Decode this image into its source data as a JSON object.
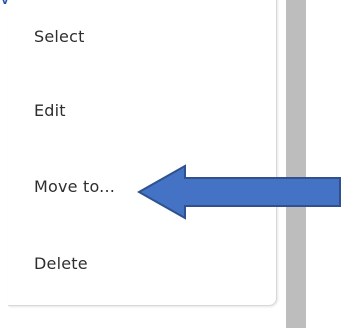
{
  "header": {
    "partial_text": "ve to"
  },
  "context_menu": {
    "items": [
      {
        "label": "Select"
      },
      {
        "label": "Edit"
      },
      {
        "label": "Move to..."
      },
      {
        "label": "Delete"
      }
    ]
  },
  "annotation": {
    "arrow_icon": "left-arrow-icon",
    "arrow_fill_color": "#4472c4",
    "arrow_stroke_color": "#2f528f"
  },
  "colors": {
    "accent_text": "#1f4fa8",
    "scrollbar": "#bdbdbd",
    "menu_text": "#2e2e2e"
  }
}
